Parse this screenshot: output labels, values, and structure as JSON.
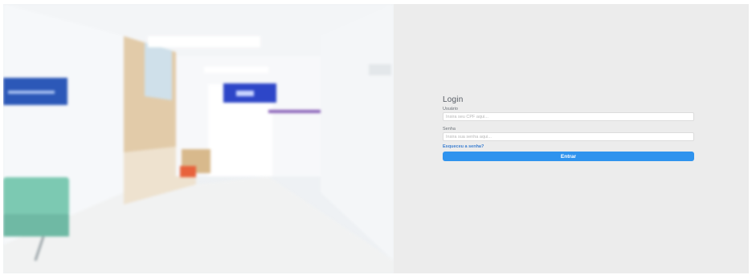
{
  "login": {
    "title": "Login",
    "username_label": "Usuário",
    "username_placeholder": "Insira seu CPF aqui...",
    "username_value": "",
    "password_label": "Senha",
    "password_placeholder": "Insira sua senha aqui...",
    "password_value": "",
    "forgot_link": "Esqueceu a senha?",
    "submit_label": "Entrar"
  },
  "colors": {
    "panel_background": "#ececec",
    "primary_button": "#2f93ee",
    "link": "#3d7fd0"
  }
}
